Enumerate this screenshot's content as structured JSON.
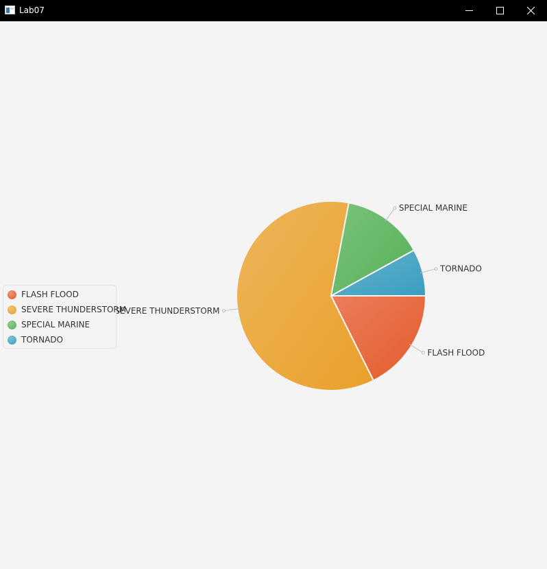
{
  "window": {
    "title": "Lab07",
    "buttons": {
      "minimize_icon": "minimize-icon",
      "maximize_icon": "maximize-icon",
      "close_icon": "close-icon"
    }
  },
  "colors": {
    "FLASH FLOOD": "#e45a2b",
    "SEVERE THUNDERSTORM": "#e9a02b",
    "SPECIAL MARINE": "#56b157",
    "TORNADO": "#3a9dbf"
  },
  "chart_data": {
    "type": "pie",
    "title": "",
    "legend_position": "left",
    "start_angle_deg": 0,
    "direction": "clockwise-on-screen from 3 o'clock: counterclockwise",
    "slices": [
      {
        "label": "FLASH FLOOD",
        "value": 17.6
      },
      {
        "label": "SEVERE THUNDERSTORM",
        "value": 60.4
      },
      {
        "label": "SPECIAL MARINE",
        "value": 14.0
      },
      {
        "label": "TORNADO",
        "value": 8.0
      }
    ]
  }
}
